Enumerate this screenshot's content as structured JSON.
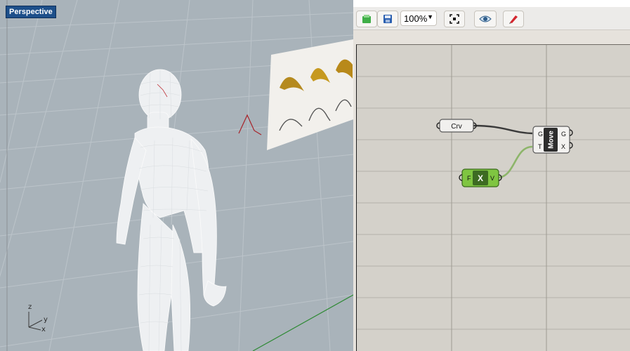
{
  "viewport": {
    "label": "Perspective",
    "axes": {
      "z": "z",
      "y": "y",
      "x": "x"
    }
  },
  "toolbar": {
    "zoom_value": "100%",
    "icons": [
      "open-file-icon",
      "save-icon",
      "zoom-selector-chevron",
      "zoom-extents-icon",
      "preview-eye-icon",
      "sketch-pen-icon"
    ]
  },
  "canvas": {
    "nodes": {
      "crv": {
        "label": "Crv"
      },
      "move": {
        "label": "Move",
        "inputs": [
          "G",
          "T"
        ],
        "outputs": [
          "G",
          "X"
        ]
      },
      "xvector": {
        "label": "X",
        "inputs": [
          "F"
        ],
        "outputs": [
          "V"
        ]
      }
    }
  },
  "colors": {
    "viewport_bg": "#a9b3ba",
    "grid_line": "#bfc7cd",
    "canvas_bg": "#d4d1ca",
    "node_green": "#7fc541",
    "wire_green": "#8db56a",
    "wire_dark": "#3a3a3a",
    "curve_red": "#a8242a"
  }
}
